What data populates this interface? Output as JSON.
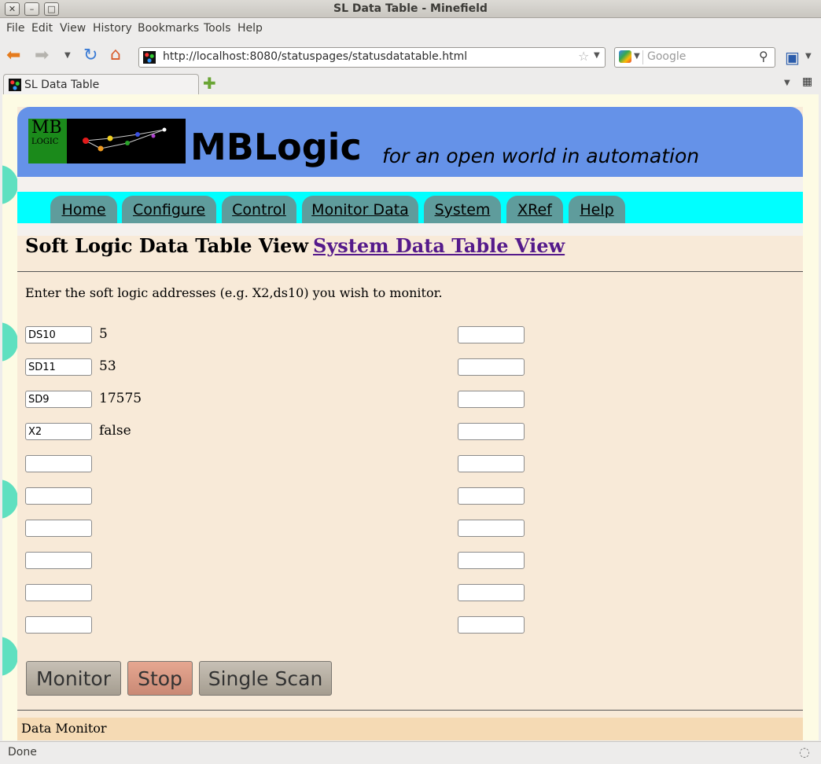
{
  "window": {
    "title": "SL Data Table - Minefield"
  },
  "menu": [
    "File",
    "Edit",
    "View",
    "History",
    "Bookmarks",
    "Tools",
    "Help"
  ],
  "toolbar": {
    "url": "http://localhost:8080/statuspages/statusdatatable.html",
    "search_placeholder": "Google"
  },
  "tab": {
    "label": "SL Data Table"
  },
  "status": {
    "text": "Done"
  },
  "page": {
    "brand": "MBLogic",
    "tagline": "for an open world in automation",
    "logo": {
      "line1": "MB",
      "line2": "LOGIC"
    },
    "nav": [
      "Home",
      "Configure",
      "Control",
      "Monitor Data",
      "System",
      "XRef",
      "Help"
    ],
    "heading": "Soft Logic Data Table View",
    "system_link": "System Data Table View",
    "intro": "Enter the soft logic addresses (e.g. X2,ds10) you wish to monitor.",
    "left_rows": [
      {
        "address": "DS10",
        "value": "5"
      },
      {
        "address": "SD11",
        "value": "53"
      },
      {
        "address": "SD9",
        "value": "17575"
      },
      {
        "address": "X2",
        "value": "false"
      },
      {
        "address": "",
        "value": ""
      },
      {
        "address": "",
        "value": ""
      },
      {
        "address": "",
        "value": ""
      },
      {
        "address": "",
        "value": ""
      },
      {
        "address": "",
        "value": ""
      },
      {
        "address": "",
        "value": ""
      }
    ],
    "right_rows": [
      "",
      "",
      "",
      "",
      "",
      "",
      "",
      "",
      "",
      ""
    ],
    "buttons": {
      "monitor": "Monitor",
      "stop": "Stop",
      "single_scan": "Single Scan"
    },
    "data_monitor": "Data Monitor"
  },
  "colors": {
    "banner": "#6592e8",
    "nav_strip": "#00ffff",
    "nav_tab": "#5f9c9c",
    "page_bg": "#f8ead8",
    "stop_button": "#d99882",
    "visited_link": "#551a8b"
  }
}
